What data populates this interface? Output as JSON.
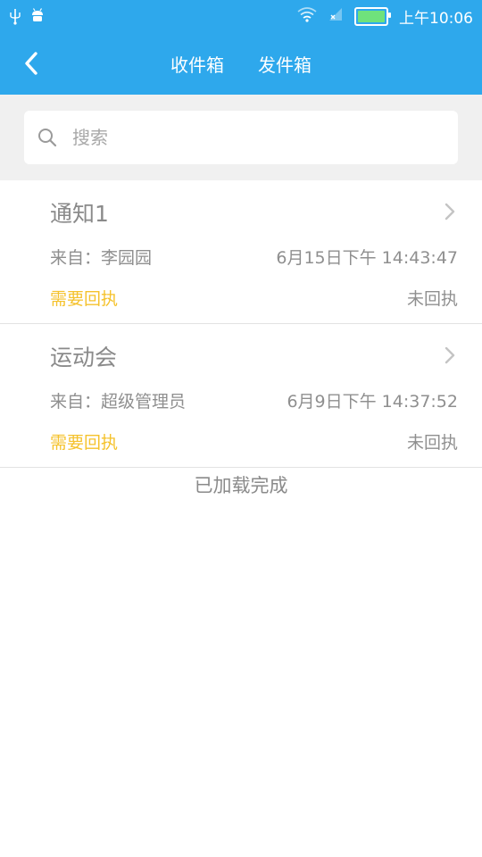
{
  "status_bar": {
    "time": "上午10:06",
    "icons": [
      "usb-icon",
      "android-debug-icon",
      "wifi-icon",
      "signal-icon",
      "battery-icon"
    ],
    "battery_color": "#6fe27c"
  },
  "header": {
    "back_icon": "chevron-left-icon",
    "tabs": [
      {
        "label": "收件箱"
      },
      {
        "label": "发件箱"
      }
    ],
    "background_color": "#2ea8ec"
  },
  "search": {
    "placeholder": "搜索",
    "value": "",
    "icon": "search-icon"
  },
  "notices": [
    {
      "title": "通知1",
      "from": "来自：李园园",
      "time": "6月15日下午 14:43:47",
      "receipt_required": "需要回执",
      "receipt_status": "未回执"
    },
    {
      "title": "运动会",
      "from": "来自：超级管理员",
      "time": "6月9日下午 14:37:52",
      "receipt_required": "需要回执",
      "receipt_status": "未回执"
    }
  ],
  "footer": {
    "load_status": "已加载完成"
  },
  "colors": {
    "accent": "#2ea8ec",
    "receipt_required": "#f5c22c",
    "muted_text": "#8a8a8a"
  }
}
